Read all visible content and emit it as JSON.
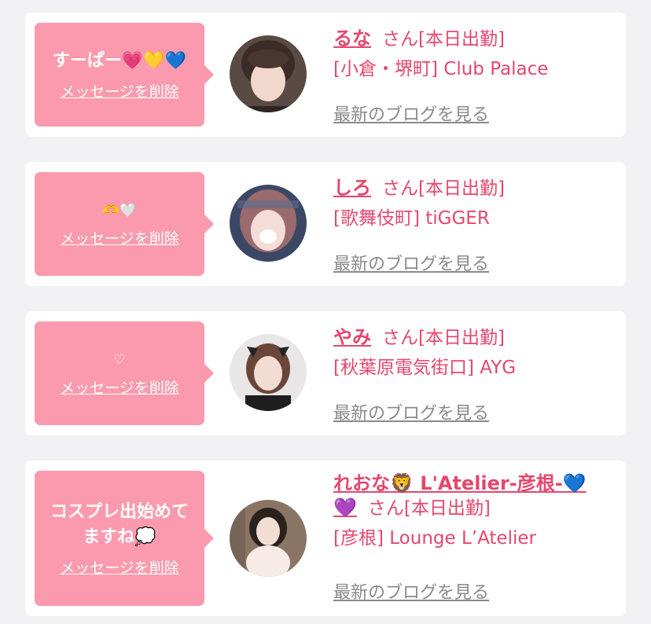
{
  "delete_label": "メッセージを削除",
  "san": "さん",
  "status": "[本日出勤]",
  "blog_label": "最新のブログを見る",
  "colors": {
    "accent": "#e5476d",
    "bubble": "#fb9aae",
    "link_gray": "#8a8a8a"
  },
  "items": [
    {
      "message": "すーぱー💗💛💙",
      "name": "るな",
      "shop": "[小倉・堺町] Club Palace",
      "avatar": "avatar-runa"
    },
    {
      "message": "🫶🤍",
      "name": "しろ",
      "shop": "[歌舞伎町] tiGGER",
      "avatar": "avatar-shiro"
    },
    {
      "message": "♡",
      "name": "やみ",
      "shop": "[秋葉原電気街口] AYG",
      "avatar": "avatar-yami"
    },
    {
      "message": "コスプレ出始めて\nますね💭",
      "name": "れおな🦁 L'Atelier-彦根-💙",
      "name2": "💜",
      "shop": "[彦根] Lounge L’Atelier",
      "avatar": "avatar-reona"
    }
  ]
}
